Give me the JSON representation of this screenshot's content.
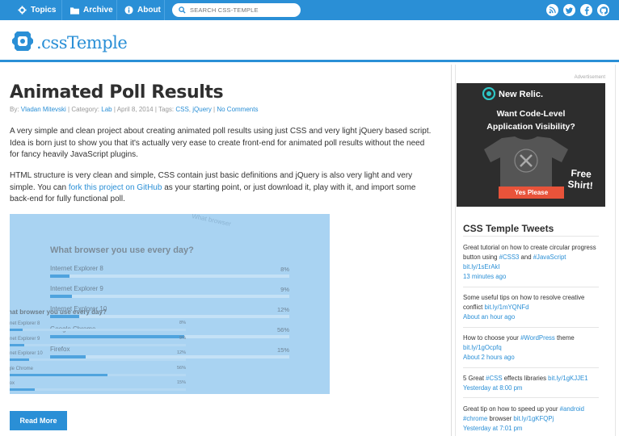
{
  "nav": {
    "topics": "Topics",
    "archive": "Archive",
    "about": "About",
    "search_placeholder": "SEARCH CSS-TEMPLE",
    "social_icons": [
      "rss-icon",
      "twitter-icon",
      "facebook-icon",
      "github-icon"
    ]
  },
  "logo": {
    "text": ".cssTemple"
  },
  "post": {
    "title": "Animated Poll Results",
    "meta": {
      "by_label": "By: ",
      "author": "Vladan Mitevski",
      "category_label": " | Category: ",
      "category": "Lab",
      "date": " | April 8, 2014 | Tags: ",
      "tag1": "CSS",
      "tag_sep": ", ",
      "tag2": "jQuery",
      "pipe": " | ",
      "comments": "No Comments"
    },
    "para1": "A very simple and clean project about creating animated poll results using just CSS and very light jQuery based script. Idea is born just to show you that it's actually very ease to create front-end for animated poll results without the need for fancy heavily JavaScript plugins.",
    "para2_before": "HTML structure is very clean and simple, CSS contain just basic definitions and jQuery is also very light and very simple. You can ",
    "para2_link": "fork this project on GitHub",
    "para2_after": " as your starting point, or just download it, play with it, and import some back-end for fully functional poll.",
    "read_more": "Read More"
  },
  "poll_image": {
    "question": "What browser you use every day?",
    "question_ghost": "What browser",
    "items": [
      {
        "label": "Internet Explorer 8",
        "percent": 8,
        "display": "8%"
      },
      {
        "label": "Internet Explorer 9",
        "percent": 9,
        "display": "9%"
      },
      {
        "label": "Internet Explorer 10",
        "percent": 12,
        "display": "12%"
      },
      {
        "label": "Google Chrome",
        "percent": 56,
        "display": "56%"
      },
      {
        "label": "Firefox",
        "percent": 15,
        "display": "15%"
      }
    ],
    "small_labels": [
      "rnet Explorer 8",
      "rnet Explorer 9",
      "rnet Explorer 10",
      "gle Chrome",
      "fox"
    ],
    "small_question": "hat browser you use every day?"
  },
  "sidebar": {
    "ad_label": "Advertisement",
    "ad": {
      "brand": "New Relic.",
      "headline1": "Want Code-Level",
      "headline2": "Application Visibility?",
      "free1": "Free",
      "free2": "Shirt!",
      "button": "Yes Please"
    },
    "tweets_title": "CSS Temple Tweets",
    "tweets": [
      {
        "text": "Great tutorial on how to create circular progress button using ",
        "tag1": "#CSS3",
        "mid": " and ",
        "tag2": "#JavaScript",
        "link": "bit.ly/1sErAkI",
        "time": "13 minutes ago"
      },
      {
        "text": "Some useful tips on how to resolve creative conflict ",
        "link": "bit.ly/1mYQNFd",
        "time": "About an hour ago"
      },
      {
        "text": "How to choose your ",
        "tag1": "#WordPress",
        "mid": " theme",
        "link": "bit.ly/1gOcpfq",
        "time": "About 2 hours ago"
      },
      {
        "text": "5 Great ",
        "tag1": "#CSS",
        "mid": " effects libraries ",
        "link": "bit.ly/1gKJJE1",
        "time": "Yesterday at 8:00 pm"
      },
      {
        "text": "Great tip on how to speed up your ",
        "tag1": "#android",
        "tag2": "#chrome",
        "mid": " browser ",
        "link": "bit.ly/1gKFQPj",
        "time": "Yesterday at 7:01 pm"
      }
    ]
  }
}
